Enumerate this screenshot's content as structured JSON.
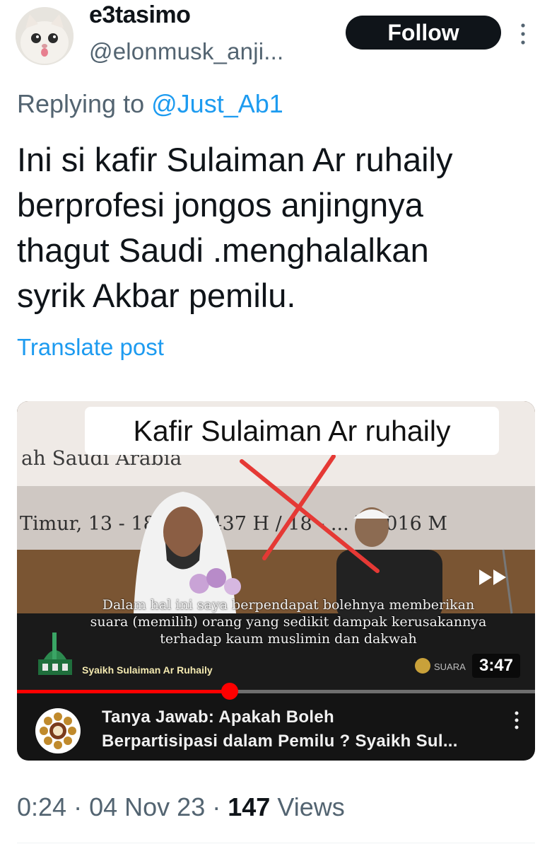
{
  "author": {
    "display_name": "e3tasimo",
    "handle": "@elonmusk_anji...",
    "avatar_icon": "cat-avatar-icon"
  },
  "follow_label": "Follow",
  "more_icon": "vertical-ellipsis-icon",
  "reply": {
    "prefix": "Replying to",
    "mention": "@Just_Ab1"
  },
  "tweet_text": "Ini si kafir Sulaiman Ar ruhaily\nberprofesi jongos anjingnya\nthagut Saudi .menghalalkan\nsyrik Akbar pemilu.",
  "translate_label": "Translate post",
  "media": {
    "overlay_caption": "Kafir Sulaiman Ar ruhaily",
    "banner_top": "ah Saudi Arabia",
    "banner_date": "Timur, 13 - 18 S... 1437 H / 18 - ... li 2016 M",
    "subtitle": "Dalam hal ini saya berpendapat bolehnya memberikan\nsuara (memilih) orang yang sedikit dampak kerusakannya\nterhadap kaum muslimin dan dakwah",
    "speaker": "Syaikh Sulaiman Ar Ruhaily",
    "watermark": "SUARA",
    "duration": "3:47",
    "progress_fraction": 0.41,
    "video_title": "Tanya Jawab: Apakah Boleh\nBerpartisipasi dalam Pemilu ? Syaikh Sul...",
    "channel_icon": "channel-logo-icon",
    "skip_icon": "fast-forward-icon",
    "menu_icon": "vertical-ellipsis-icon"
  },
  "meta": {
    "time": "0:24",
    "date": "04 Nov 23",
    "views_count": "147",
    "views_label": "Views"
  },
  "colors": {
    "accent": "#1d9bf0",
    "text_primary": "#0f1419",
    "text_secondary": "#536471",
    "follow_bg": "#0f1419",
    "progress": "#ff0000",
    "cross": "#e53935"
  }
}
